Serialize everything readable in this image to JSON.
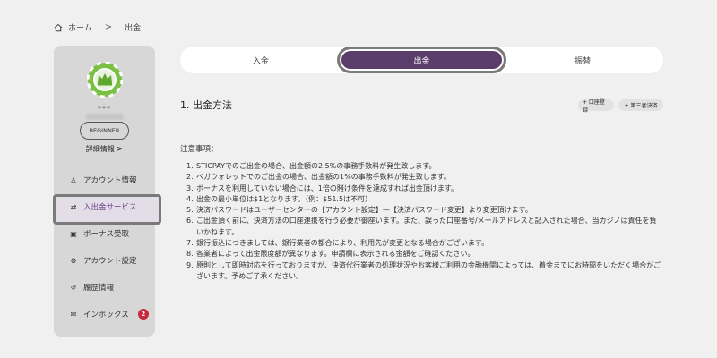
{
  "breadcrumb": {
    "home": "ホーム",
    "separator": ">",
    "current": "出金"
  },
  "user": {
    "avatar_icon": "crown-chip-icon",
    "masked_id": "***",
    "level": "BEGINNER",
    "details_link": "詳細情報",
    "details_chevron": ">"
  },
  "sidebar": {
    "items": [
      {
        "label": "アカウント情報",
        "icon": "person-icon",
        "glyph": "♙"
      },
      {
        "label": "入出金サービス",
        "icon": "money-transfer-icon",
        "glyph": "⇄",
        "active": true
      },
      {
        "label": "ボーナス受取",
        "icon": "bonus-icon",
        "glyph": "▣"
      },
      {
        "label": "アカウント設定",
        "icon": "gear-icon",
        "glyph": "⚙"
      },
      {
        "label": "履歴情報",
        "icon": "history-icon",
        "glyph": "↺"
      },
      {
        "label": "インボックス",
        "icon": "mail-icon",
        "glyph": "✉",
        "badge": "2"
      }
    ]
  },
  "tabs": [
    {
      "label": "入金"
    },
    {
      "label": "出金",
      "active": true
    },
    {
      "label": "振替"
    }
  ],
  "main": {
    "section_title": "1. 出金方法",
    "buttons": {
      "account_register": "+ 口座登録",
      "third_party": "+ 第三者決済"
    },
    "notes_heading": "注意事項：",
    "notes": [
      {
        "num": "1.",
        "text": "STICPAYでのご出金の場合、出金額の2.5%の事務手数料が発生致します。"
      },
      {
        "num": "2.",
        "text": "ベガウォレットでのご出金の場合、出金額の1%の事務手数料が発生致します。"
      },
      {
        "num": "3.",
        "text": "ボーナスを利用していない場合には、1倍の賭け条件を達成すれば出金頂けます。"
      },
      {
        "num": "4.",
        "text": "出金の最小単位は$1となります。（例：$51.5は不可）"
      },
      {
        "num": "5.",
        "text": "決済パスワードはユーザーセンターの【アカウント設定】—【決済パスワード変更】より変更頂けます。"
      },
      {
        "num": "6.",
        "text": "ご出金頂く前に、決済方法の口座連携を行う必要が御座います。また、誤った口座番号/メールアドレスと記入された場合、当カジノは責任を負いかねます。"
      },
      {
        "num": "7.",
        "text": "銀行振込につきましては、銀行業者の都合により、利用先が変更となる場合がございます。"
      },
      {
        "num": "8.",
        "text": "各業者によって出金限度額が異なります。申請欄に表示される金額をご確認ください。"
      },
      {
        "num": "9.",
        "text": "原則として即時対応を行っておりますが、決済代行業者の処理状況やお客様ご利用の金融機関によっては、着金までにお時間をいただく場合がございます。予めご了承ください。"
      }
    ]
  },
  "colors": {
    "accent": "#5a3d6b",
    "active_text": "#6a3f8a",
    "badge": "#c8283a"
  }
}
